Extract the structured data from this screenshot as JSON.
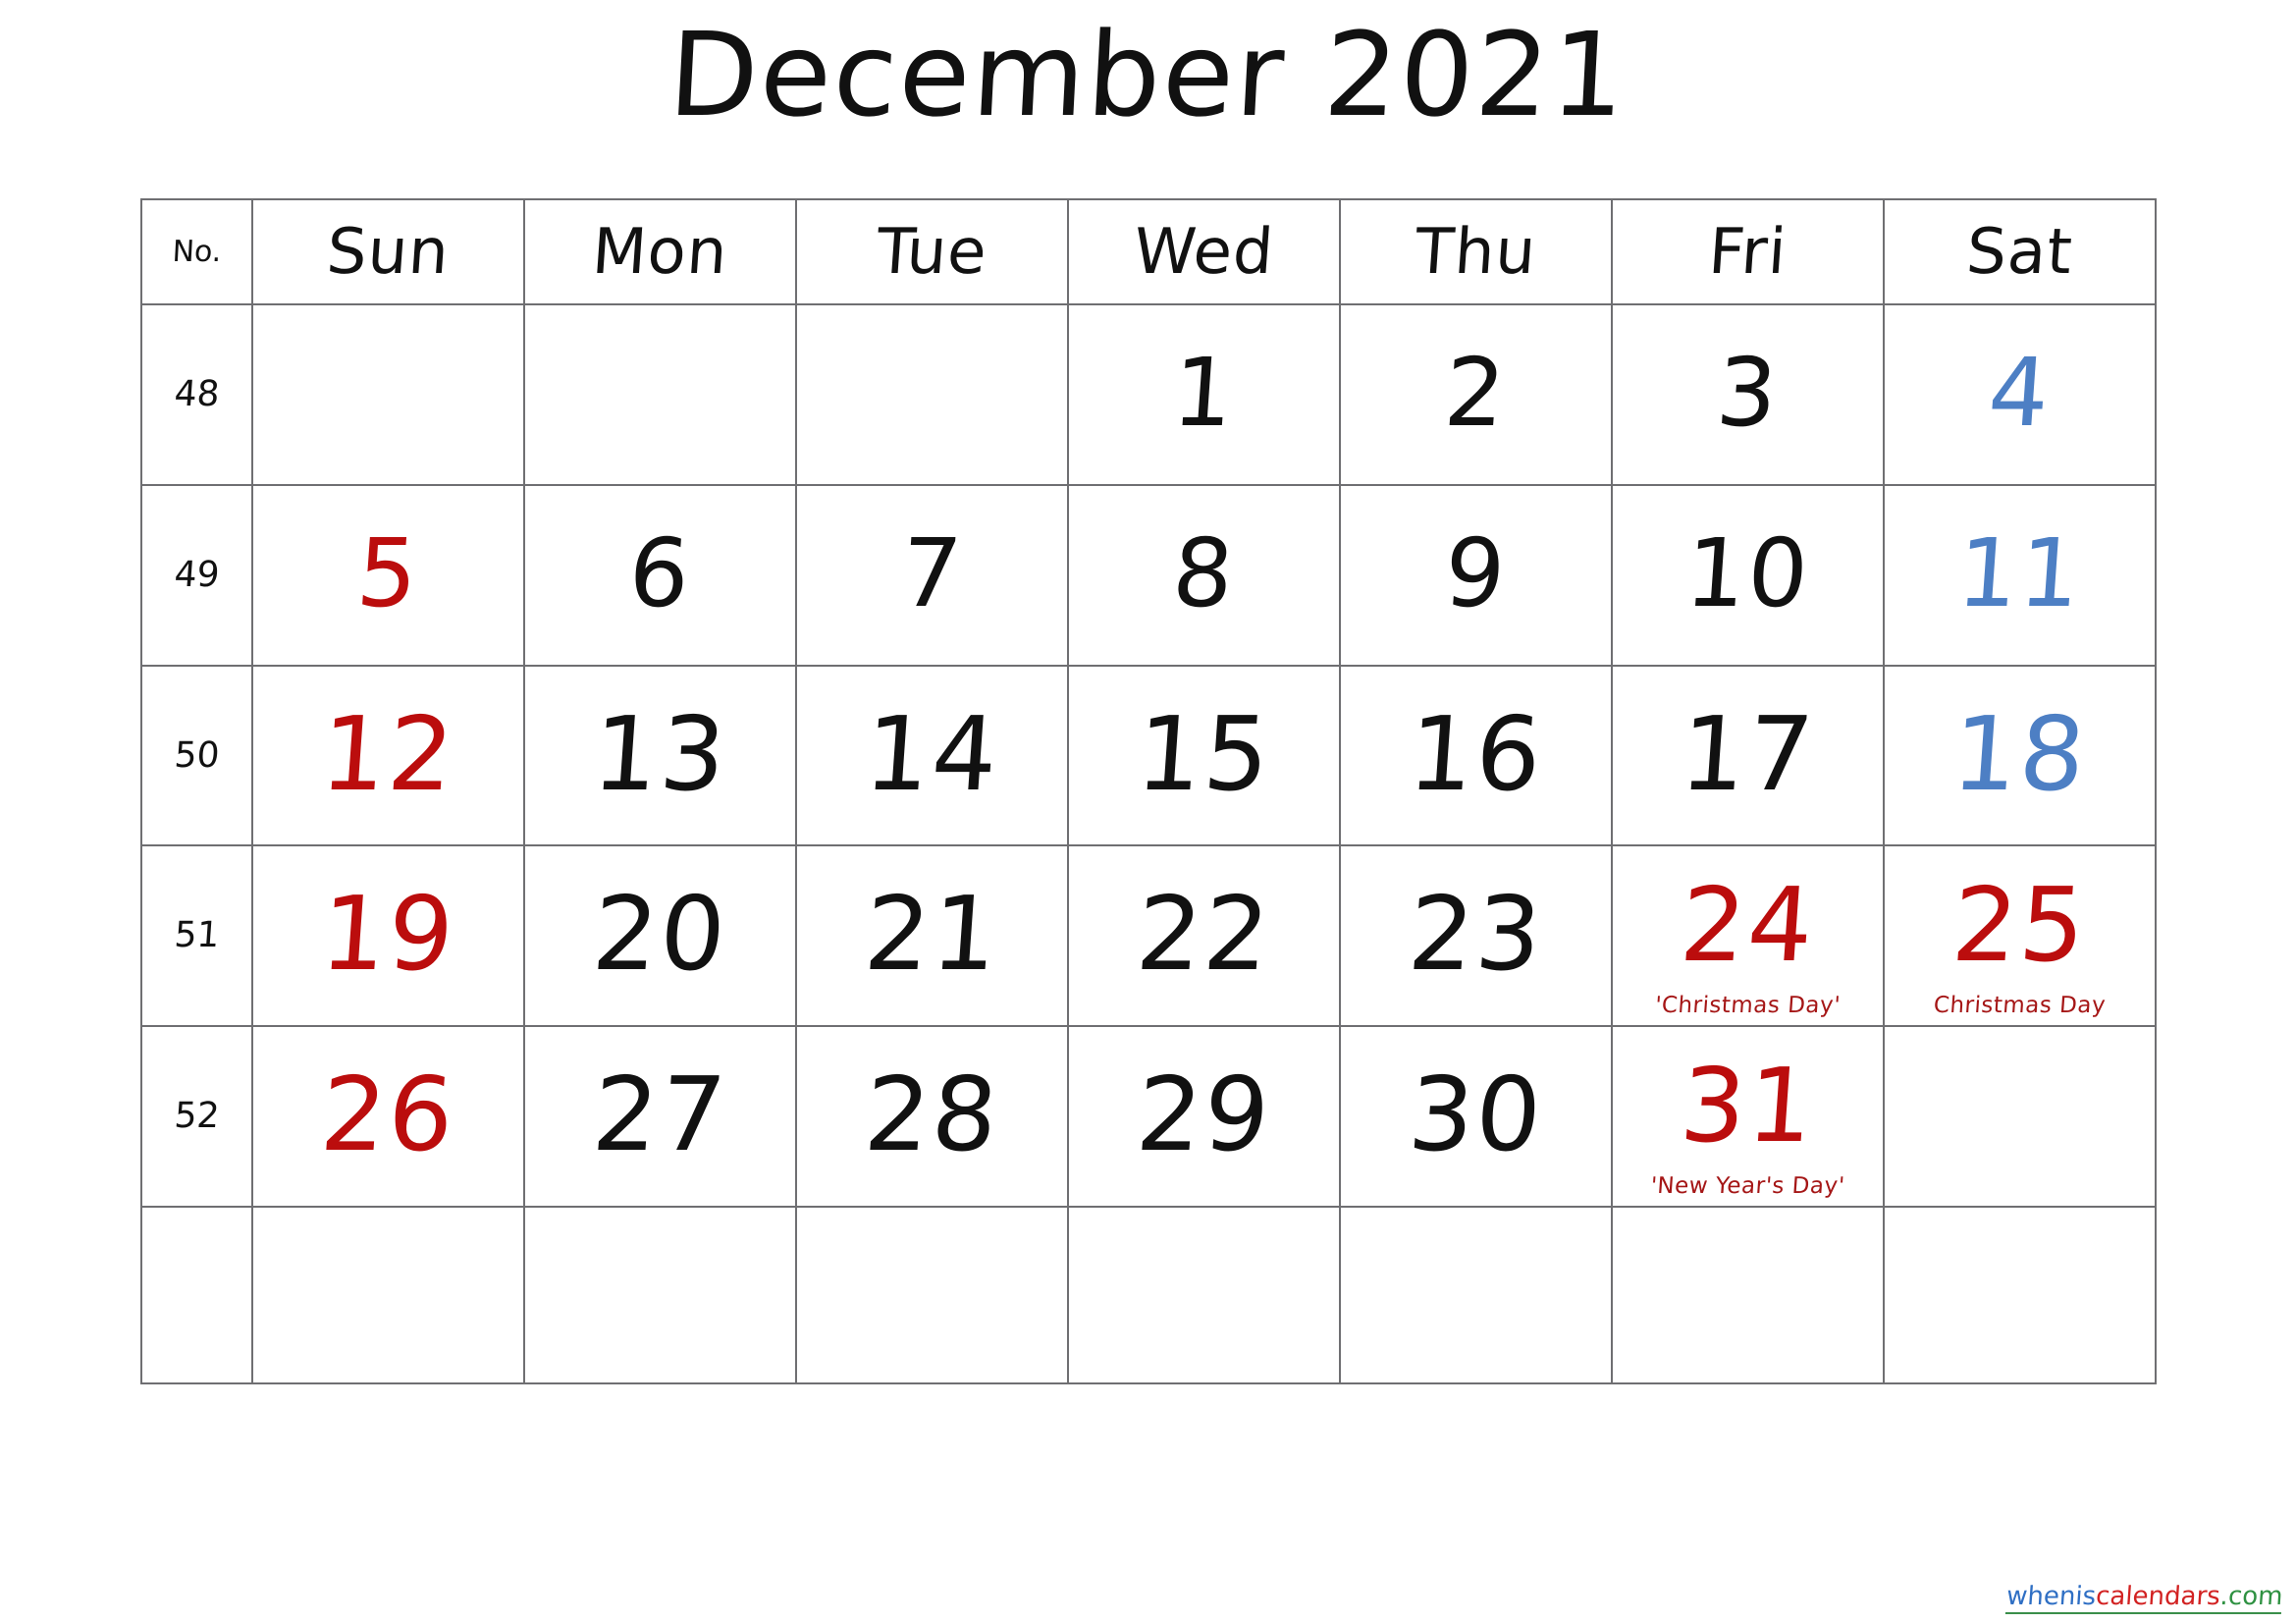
{
  "title": "December 2021",
  "colors": {
    "sunday_red": "#bb0d0d",
    "saturday_blue": "#4d7fc4",
    "holiday_red": "#a51616",
    "weekday_black": "#111111",
    "grid_line": "#6f6f72",
    "watermark_blue": "#2f6fc4",
    "watermark_red": "#d22222",
    "watermark_green": "#2f9142"
  },
  "header": {
    "week_no_label": "No.",
    "days": [
      "Sun",
      "Mon",
      "Tue",
      "Wed",
      "Thu",
      "Fri",
      "Sat"
    ]
  },
  "weeks": [
    {
      "no": "48",
      "cells": [
        {
          "num": "",
          "color": "black",
          "holiday": ""
        },
        {
          "num": "",
          "color": "black",
          "holiday": ""
        },
        {
          "num": "",
          "color": "black",
          "holiday": ""
        },
        {
          "num": "1",
          "color": "black",
          "holiday": ""
        },
        {
          "num": "2",
          "color": "black",
          "holiday": ""
        },
        {
          "num": "3",
          "color": "black",
          "holiday": ""
        },
        {
          "num": "4",
          "color": "blue",
          "holiday": ""
        }
      ]
    },
    {
      "no": "49",
      "cells": [
        {
          "num": "5",
          "color": "red",
          "holiday": ""
        },
        {
          "num": "6",
          "color": "black",
          "holiday": ""
        },
        {
          "num": "7",
          "color": "black",
          "holiday": ""
        },
        {
          "num": "8",
          "color": "black",
          "holiday": ""
        },
        {
          "num": "9",
          "color": "black",
          "holiday": ""
        },
        {
          "num": "10",
          "color": "black",
          "holiday": ""
        },
        {
          "num": "11",
          "color": "blue",
          "holiday": ""
        }
      ]
    },
    {
      "no": "50",
      "cells": [
        {
          "num": "12",
          "color": "red",
          "holiday": ""
        },
        {
          "num": "13",
          "color": "black",
          "holiday": ""
        },
        {
          "num": "14",
          "color": "black",
          "holiday": ""
        },
        {
          "num": "15",
          "color": "black",
          "holiday": ""
        },
        {
          "num": "16",
          "color": "black",
          "holiday": ""
        },
        {
          "num": "17",
          "color": "black",
          "holiday": ""
        },
        {
          "num": "18",
          "color": "blue",
          "holiday": ""
        }
      ]
    },
    {
      "no": "51",
      "cells": [
        {
          "num": "19",
          "color": "red",
          "holiday": ""
        },
        {
          "num": "20",
          "color": "black",
          "holiday": ""
        },
        {
          "num": "21",
          "color": "black",
          "holiday": ""
        },
        {
          "num": "22",
          "color": "black",
          "holiday": ""
        },
        {
          "num": "23",
          "color": "black",
          "holiday": ""
        },
        {
          "num": "24",
          "color": "red",
          "holiday": "'Christmas Day'"
        },
        {
          "num": "25",
          "color": "red",
          "holiday": "Christmas Day"
        }
      ]
    },
    {
      "no": "52",
      "cells": [
        {
          "num": "26",
          "color": "red",
          "holiday": ""
        },
        {
          "num": "27",
          "color": "black",
          "holiday": ""
        },
        {
          "num": "28",
          "color": "black",
          "holiday": ""
        },
        {
          "num": "29",
          "color": "black",
          "holiday": ""
        },
        {
          "num": "30",
          "color": "black",
          "holiday": ""
        },
        {
          "num": "31",
          "color": "red",
          "holiday": "'New Year's Day'"
        },
        {
          "num": "",
          "color": "black",
          "holiday": ""
        }
      ]
    },
    {
      "no": "",
      "cells": [
        {
          "num": "",
          "color": "black",
          "holiday": ""
        },
        {
          "num": "",
          "color": "black",
          "holiday": ""
        },
        {
          "num": "",
          "color": "black",
          "holiday": ""
        },
        {
          "num": "",
          "color": "black",
          "holiday": ""
        },
        {
          "num": "",
          "color": "black",
          "holiday": ""
        },
        {
          "num": "",
          "color": "black",
          "holiday": ""
        },
        {
          "num": "",
          "color": "black",
          "holiday": ""
        }
      ]
    }
  ],
  "watermark": {
    "part_a": "whenis",
    "part_b": "calendars",
    "part_c": ".com"
  }
}
